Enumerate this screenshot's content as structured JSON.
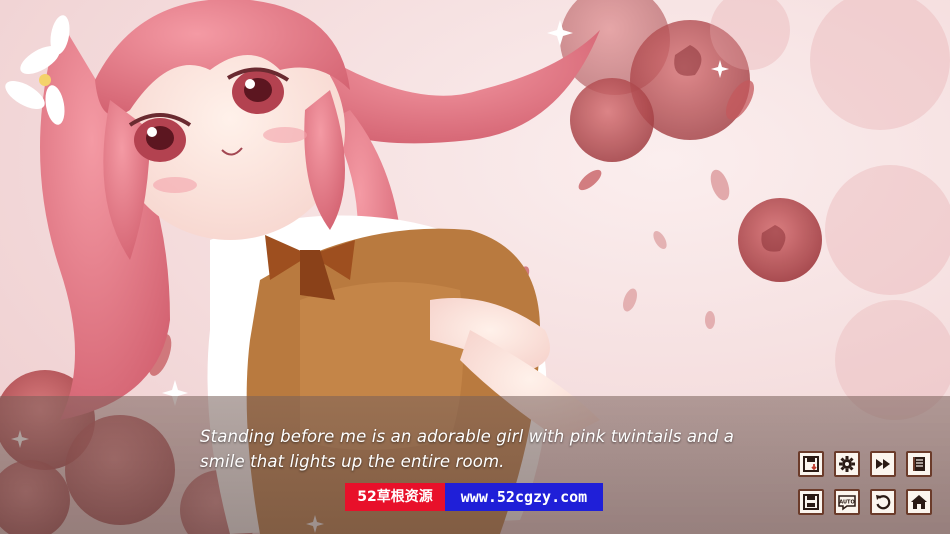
{
  "dialog": {
    "line1": "Standing before me is an adorable girl with pink twintails and a",
    "line2": "smile that lights up the entire room."
  },
  "watermark": {
    "site_name": "52草根资源",
    "site_url": "www.52cgzy.com",
    "left_color": "#e8102a",
    "right_color": "#1f1fd8"
  },
  "quick_menu": {
    "row1": [
      "save-icon",
      "settings-icon",
      "skip-icon",
      "history-icon"
    ],
    "row2": [
      "quick-save-icon",
      "auto-icon",
      "rollback-icon",
      "home-icon"
    ],
    "auto_label": "AUTO"
  },
  "colors": {
    "hair": "#e0707e",
    "rose": "#b8454a",
    "button_border": "#6b3b2a",
    "button_fill": "#fbf5ee"
  }
}
